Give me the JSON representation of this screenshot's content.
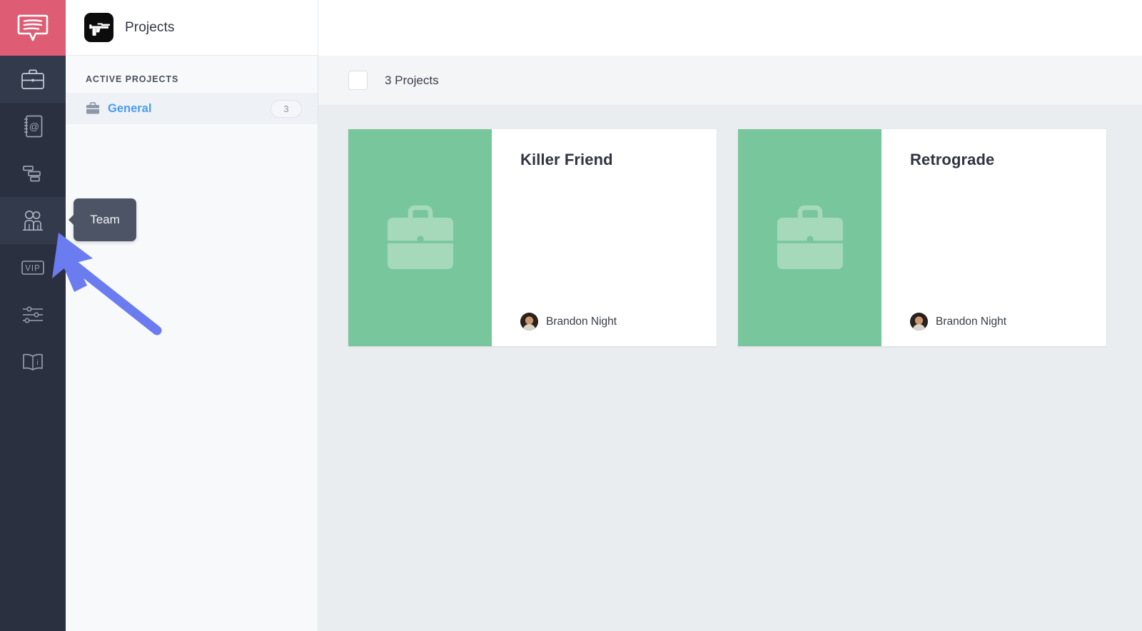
{
  "brand": {
    "logo_icon": "submachine-gun-logo",
    "title": "Projects",
    "rail_logo_icon": "speech-bubble-logo",
    "accent_red": "#de5d74",
    "rail_bg": "#2b3040"
  },
  "rail": {
    "items": [
      {
        "icon": "briefcase-icon",
        "name": "projects",
        "active": true
      },
      {
        "icon": "contacts-book-icon",
        "name": "contacts",
        "active": false
      },
      {
        "icon": "gantt-chart-icon",
        "name": "schedule",
        "active": false
      },
      {
        "icon": "team-people-icon",
        "name": "team",
        "active": true
      },
      {
        "icon": "vip-badge-icon",
        "name": "vip",
        "active": false
      },
      {
        "icon": "sliders-icon",
        "name": "settings",
        "active": false
      },
      {
        "icon": "manual-book-icon",
        "name": "help",
        "active": false
      }
    ]
  },
  "panel": {
    "section_label": "ACTIVE PROJECTS",
    "items": [
      {
        "icon": "briefcase-icon",
        "label": "General",
        "count": "3",
        "selected": true
      }
    ]
  },
  "toolbar": {
    "select_all_checked": false,
    "count_label": "3 Projects"
  },
  "cards": [
    {
      "title": "Killer Friend",
      "owner": "Brandon Night",
      "thumb_icon": "briefcase-icon",
      "thumb_color": "#78c69c"
    },
    {
      "title": "Retrograde",
      "owner": "Brandon Night",
      "thumb_icon": "briefcase-icon",
      "thumb_color": "#78c69c"
    }
  ],
  "tooltip": {
    "label": "Team"
  },
  "annotation": {
    "pointer_color": "#6a7cf0"
  }
}
